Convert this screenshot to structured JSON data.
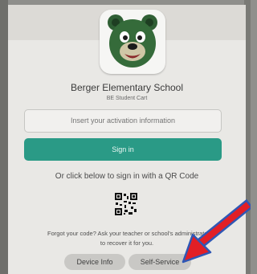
{
  "school": {
    "name": "Berger Elementary School",
    "cart_name": "BE Student Cart",
    "logo": "bear-mascot-icon"
  },
  "form": {
    "activation_placeholder": "Insert your activation information",
    "sign_in_label": "Sign in"
  },
  "qr": {
    "instruction": "Or click below to sign in with a QR Code",
    "icon": "qr-code-icon"
  },
  "help": {
    "line1": "Forgot your code? Ask your teacher or school's administrator",
    "line2": "to recover it for you."
  },
  "footer": {
    "device_info_label": "Device Info",
    "self_service_label": "Self-Service"
  },
  "colors": {
    "accent": "#2a9a86",
    "arrow": "#e21f26",
    "arrow_outline": "#2f57b5"
  }
}
